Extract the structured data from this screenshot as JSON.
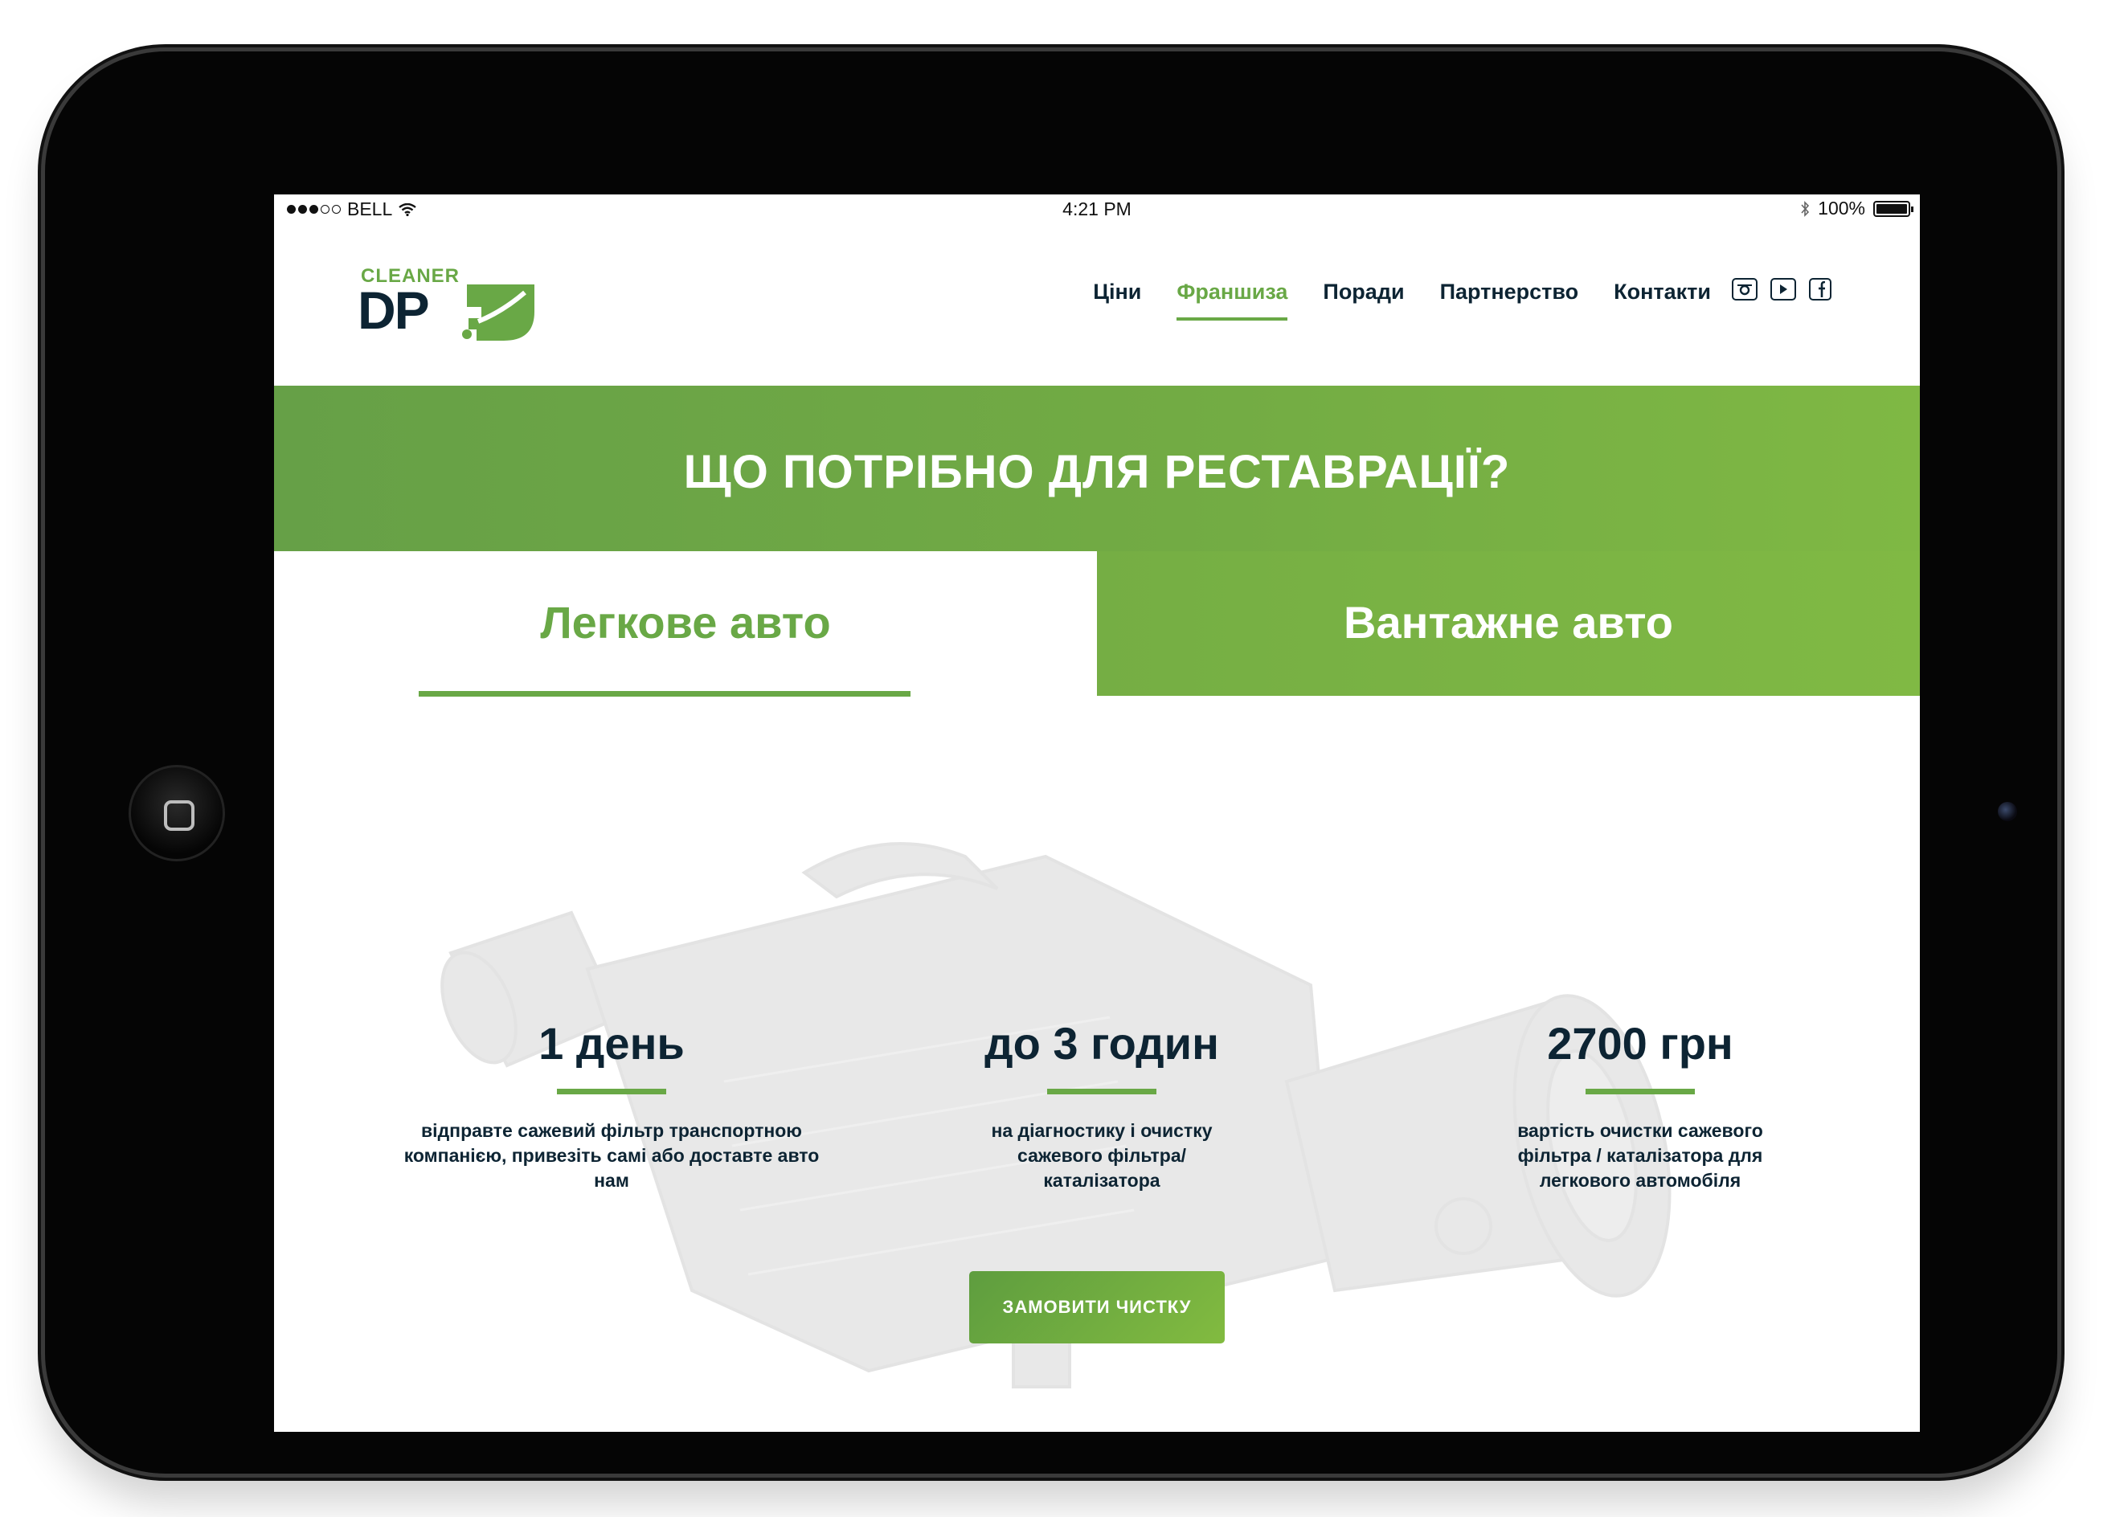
{
  "statusbar": {
    "carrier": "BELL",
    "time": "4:21 PM",
    "battery": "100%"
  },
  "logo": {
    "small": "CLEANER",
    "big": "DP"
  },
  "nav": {
    "items": [
      {
        "label": "Ціни"
      },
      {
        "label": "Франшиза"
      },
      {
        "label": "Поради"
      },
      {
        "label": "Партнерство"
      },
      {
        "label": "Контакти"
      }
    ],
    "active": "Франшиза"
  },
  "social": {
    "icons": [
      "instagram-icon",
      "youtube-icon",
      "facebook-icon"
    ]
  },
  "banner": {
    "title": "ЩО ПОТРІБНО ДЛЯ РЕСТАВРАЦІЇ?"
  },
  "tabs": [
    {
      "label": "Легкове авто",
      "active": true
    },
    {
      "label": "Вантажне авто",
      "active": false
    }
  ],
  "stats": [
    {
      "value": "1 день",
      "text": "відправте сажевий фільтр транспортною компанією, привезіть самі або доставте авто нам"
    },
    {
      "value": "до 3 годин",
      "text": "на діагностику і очистку сажевого фільтра/каталізатора"
    },
    {
      "value": "2700 грн",
      "text": "вартість очистки сажевого фільтра / каталізатора для легкового автомобіля"
    }
  ],
  "cta": {
    "label": "ЗАМОВИТИ ЧИСТКУ"
  },
  "colors": {
    "brand_green": "#69a846",
    "dark_navy": "#0d2433",
    "background": "#ffffff"
  }
}
